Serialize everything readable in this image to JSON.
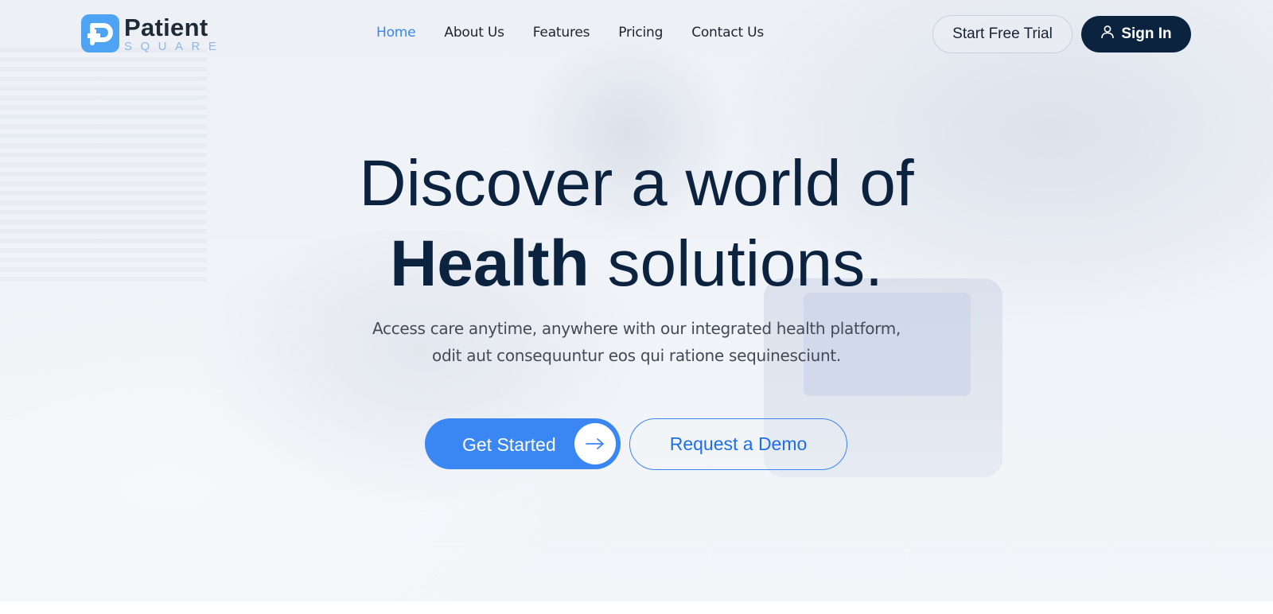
{
  "brand": {
    "name": "Patient",
    "tagline": "SQUARE"
  },
  "nav": {
    "items": [
      {
        "label": "Home",
        "active": true
      },
      {
        "label": "About Us",
        "active": false
      },
      {
        "label": "Features",
        "active": false
      },
      {
        "label": "Pricing",
        "active": false
      },
      {
        "label": "Contact Us",
        "active": false
      }
    ]
  },
  "header_actions": {
    "trial_label": "Start Free Trial",
    "signin_label": "Sign In",
    "signin_icon": "user-icon"
  },
  "hero": {
    "headline_line1": "Discover a world of",
    "headline_bold": "Health",
    "headline_rest": "solutions.",
    "subtext_line1": "Access care anytime, anywhere with our integrated health platform,",
    "subtext_line2": "odit aut consequuntur eos qui ratione sequinesciunt.",
    "primary_cta": "Get Started",
    "primary_cta_icon": "arrow-right-icon",
    "secondary_cta": "Request a Demo"
  },
  "colors": {
    "navy": "#0c2340",
    "accent": "#3a86f2",
    "logo_blue": "#4fa3f4"
  }
}
